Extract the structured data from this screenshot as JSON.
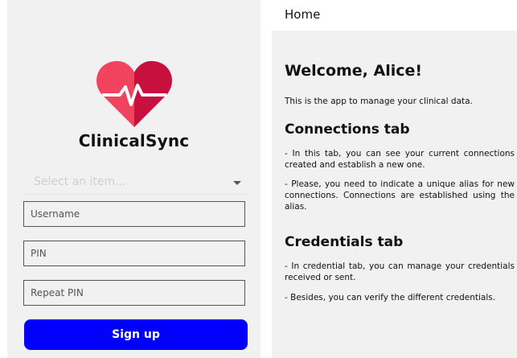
{
  "login": {
    "app_name": "ClinicalSync",
    "select_placeholder": "Select an item...",
    "username_placeholder": "Username",
    "pin_placeholder": "PIN",
    "repeat_pin_placeholder": "Repeat PIN",
    "signup_label": "Sign up",
    "colors": {
      "button": "#0000fc",
      "heart_light": "#f2435e",
      "heart_dark": "#c8103f"
    }
  },
  "home": {
    "header_title": "Home",
    "welcome": "Welcome, Alice!",
    "intro": "This is the app to manage your clinical data.",
    "connections_title": "Connections tab",
    "connections_p1": "- In this tab, you can see your current connections created and establish a new one.",
    "connections_p2": "- Please, you need to indicate a unique alias for new connections. Connections are established using the alias.",
    "credentials_title": "Credentials tab",
    "credentials_p1": "- In credential tab, you can manage your credentials received or sent.",
    "credentials_p2": "- Besides, you can verify the different credentials."
  }
}
